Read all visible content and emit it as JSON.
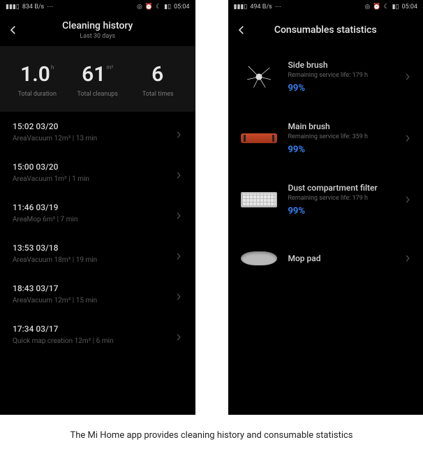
{
  "status": {
    "time": "05:04",
    "net": "834 B/s",
    "net2": "494 B/s"
  },
  "left": {
    "title": "Cleaning history",
    "subtitle": "Last 30 days",
    "summary": [
      {
        "value": "1.0",
        "unit": "h",
        "label": "Total duration"
      },
      {
        "value": "61",
        "unit": "m²",
        "label": "Total cleanups"
      },
      {
        "value": "6",
        "unit": "",
        "label": "Total times"
      }
    ],
    "history": [
      {
        "t": "15:02 03/20",
        "d": "AreaVacuum 12m² | 13 min"
      },
      {
        "t": "15:00 03/20",
        "d": "AreaVacuum 1m² | 1 min"
      },
      {
        "t": "11:46 03/19",
        "d": "AreaMop 6m² | 7 min"
      },
      {
        "t": "13:53 03/18",
        "d": "AreaVacuum 18m² | 19 min"
      },
      {
        "t": "18:43 03/17",
        "d": "AreaVacuum 12m² | 15 min"
      },
      {
        "t": "17:34 03/17",
        "d": "Quick map creation 12m² | 6 min"
      }
    ]
  },
  "right": {
    "title": "Consumables statistics",
    "items": [
      {
        "name": "Side brush",
        "life": "Remaining service life: 179 h",
        "pct": "99%",
        "icon": "side-brush"
      },
      {
        "name": "Main brush",
        "life": "Remaining service life: 359 h",
        "pct": "99%",
        "icon": "main-brush"
      },
      {
        "name": "Dust compartment filter",
        "life": "Remaining service life: 179 h",
        "pct": "99%",
        "icon": "filter"
      },
      {
        "name": "Mop pad",
        "life": "",
        "pct": "",
        "icon": "mop-pad"
      }
    ]
  },
  "caption": "The Mi Home app provides cleaning history and consumable statistics"
}
